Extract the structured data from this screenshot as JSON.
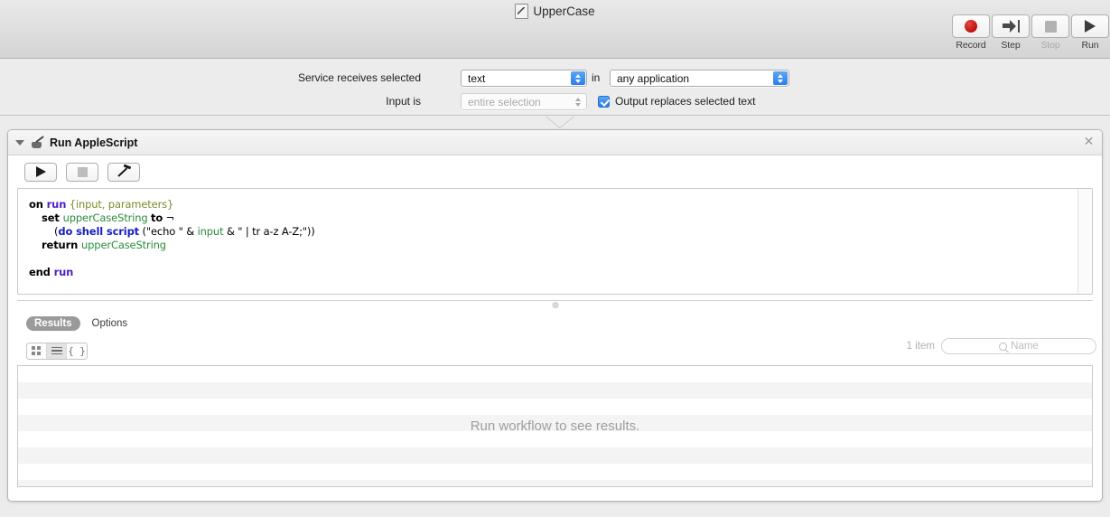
{
  "window": {
    "title": "UpperCase",
    "doc_icon": "automator-document-icon"
  },
  "toolbar": {
    "buttons": [
      {
        "label": "Record",
        "icon": "record-icon",
        "enabled": true
      },
      {
        "label": "Step",
        "icon": "step-icon",
        "enabled": true
      },
      {
        "label": "Stop",
        "icon": "stop-icon",
        "enabled": false
      },
      {
        "label": "Run",
        "icon": "run-icon",
        "enabled": true
      }
    ]
  },
  "settings": {
    "receives_label": "Service receives selected",
    "receives_value": "text",
    "in_label": "in",
    "application_value": "any application",
    "input_is_label": "Input is",
    "input_is_value": "entire selection",
    "output_replaces_label": "Output replaces selected text",
    "output_replaces_checked": true
  },
  "action": {
    "title": "Run AppleScript",
    "icon": "applescript-icon",
    "close_icon": "close-icon",
    "buttons": [
      {
        "name": "run",
        "icon": "play-icon",
        "enabled": true
      },
      {
        "name": "stop",
        "icon": "stop-square-icon",
        "enabled": false
      },
      {
        "name": "compile",
        "icon": "hammer-icon",
        "enabled": true
      }
    ],
    "script_lines": [
      [
        {
          "t": "on ",
          "c": "k-bold"
        },
        {
          "t": "run",
          "c": "k-res"
        },
        {
          "t": " ",
          "c": "k-plain"
        },
        {
          "t": "{input, parameters}",
          "c": "k-param"
        }
      ],
      [
        {
          "t": "    ",
          "c": "k-plain"
        },
        {
          "t": "set ",
          "c": "k-bold"
        },
        {
          "t": "upperCaseString",
          "c": "k-var"
        },
        {
          "t": " ",
          "c": "k-plain"
        },
        {
          "t": "to",
          "c": "k-bold"
        },
        {
          "t": " ¬",
          "c": "k-plain"
        }
      ],
      [
        {
          "t": "        (",
          "c": "k-plain"
        },
        {
          "t": "do shell script",
          "c": "k-cmd"
        },
        {
          "t": " (\"echo \" & ",
          "c": "k-plain"
        },
        {
          "t": "input",
          "c": "k-var"
        },
        {
          "t": " & \" | tr a-z A-Z;\"))",
          "c": "k-plain"
        }
      ],
      [
        {
          "t": "    ",
          "c": "k-plain"
        },
        {
          "t": "return ",
          "c": "k-bold"
        },
        {
          "t": "upperCaseString",
          "c": "k-var"
        }
      ],
      [
        {
          "t": "",
          "c": "k-plain"
        }
      ],
      [
        {
          "t": "end ",
          "c": "k-bold"
        },
        {
          "t": "run",
          "c": "k-res"
        }
      ]
    ]
  },
  "results": {
    "tabs": [
      {
        "label": "Results",
        "active": true
      },
      {
        "label": "Options",
        "active": false
      }
    ],
    "view_modes": [
      {
        "name": "grid-view",
        "icon": "grid-icon",
        "active": false
      },
      {
        "name": "list-view",
        "icon": "list-icon",
        "active": true
      },
      {
        "name": "code-view",
        "icon": "braces-icon",
        "active": false
      }
    ],
    "item_count": "1 item",
    "search_placeholder": "Name",
    "search_value": "",
    "empty_message": "Run workflow to see results."
  }
}
